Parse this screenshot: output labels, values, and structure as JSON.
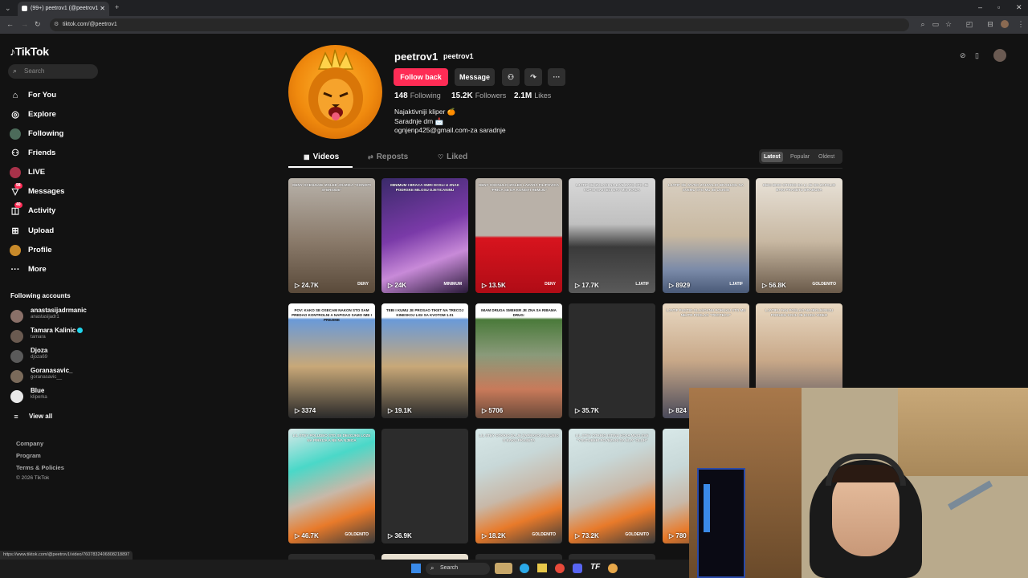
{
  "browser": {
    "tab_title": "(99+) peetrov1 (@peetrov1",
    "url": "tiktok.com/@peetrov1"
  },
  "sidebar": {
    "logo": "TikTok",
    "search_placeholder": "Search",
    "nav": [
      {
        "label": "For You",
        "icon": "home-icon"
      },
      {
        "label": "Explore",
        "icon": "compass-icon"
      },
      {
        "label": "Following",
        "icon": "following-avatar"
      },
      {
        "label": "Friends",
        "icon": "friends-icon"
      },
      {
        "label": "LIVE",
        "icon": "live-icon"
      },
      {
        "label": "Messages",
        "icon": "inbox-icon",
        "badge": "98"
      },
      {
        "label": "Activity",
        "icon": "bell-icon",
        "badge": "40"
      },
      {
        "label": "Upload",
        "icon": "plus-square-icon"
      },
      {
        "label": "Profile",
        "icon": "profile-avatar"
      },
      {
        "label": "More",
        "icon": "more-icon"
      }
    ],
    "following_heading": "Following accounts",
    "following": [
      {
        "name": "anastasijadrmanic",
        "handle": "anastasijadr1",
        "verified": false
      },
      {
        "name": "Tamara Kalinic",
        "handle": "tamara",
        "verified": true
      },
      {
        "name": "Djoza",
        "handle": "djoza69",
        "verified": false
      },
      {
        "name": "Goranasavic_",
        "handle": "goranasavic__",
        "verified": false
      },
      {
        "name": "Blue",
        "handle": "kliperka",
        "verified": false
      }
    ],
    "view_all": "View all",
    "footer": [
      "Company",
      "Program",
      "Terms & Policies",
      "© 2026 TikTok"
    ]
  },
  "profile": {
    "username": "peetrov1",
    "nickname": "peetrov1",
    "follow_back": "Follow back",
    "message": "Message",
    "following_count": "148",
    "following_label": "Following",
    "followers_count": "15.2K",
    "followers_label": "Followers",
    "likes_count": "2.1M",
    "likes_label": "Likes",
    "bio": [
      "Najaktivniji kliper 🍊",
      "Saradnje dm 📩",
      "ognjenp425@gmail.com-za saradnje"
    ]
  },
  "tabs": [
    "Videos",
    "Reposts",
    "Liked"
  ],
  "sort": [
    "Latest",
    "Popular",
    "Oldest"
  ],
  "videos": [
    {
      "views": "24.7K",
      "caption": "DENY OCENJUJE IZGLED JOJZIKA \"KONISTI STERIODE\"",
      "wm": "DENY"
    },
    {
      "views": "24K",
      "caption": "MINIMUM I BRACA SMRI DOSLI U ZNAK PODRSKE MILOSU DJETICANINU",
      "wm": "MINIMUM"
    },
    {
      "views": "13.5K",
      "caption": "DENY OSKNULO IZGLED LAZARA FILIPOVICA \"PRICA SE DA KONISTI HEMIJU\"",
      "wm": "DENY"
    },
    {
      "views": "17.7K",
      "caption": "LJATIF SE IZVLACI NA LIVE ZATO STO JE KUPIO NAJVECI DAY MIS IKADA",
      "wm": "LJATIF"
    },
    {
      "views": "8929",
      "caption": "LJATIF SE JAVNO ZAHVALIO BRABUSU NA SVEMU STO MU JE UCINIO",
      "wm": "LJATIF"
    },
    {
      "views": "56.8K",
      "caption": "DEKI BMW OTKRIO DA LI JE ON ZAPALIO BAKI PRASETU BRABUSA",
      "wm": "GOLDENITO"
    },
    {
      "views": "3374",
      "caption": "POV: KAKO SE OSECAM NAKON STO SAM PREDAO KONTROLNI A NAPISAO SAMO IME I PREZIME",
      "wm": ""
    },
    {
      "views": "19.1K",
      "caption": "TEBI I KUMU JE PROSAO TIKET NA TRECOJ KINESKOJ LIGI SA KVOTOM 1.01",
      "wm": ""
    },
    {
      "views": "5706",
      "caption": "IMAM DRUGA SMEKER JE ZNA SA RIBAMA DRUG:",
      "wm": ""
    },
    {
      "views": "35.7K",
      "caption": "",
      "wm": ""
    },
    {
      "views": "824",
      "caption": "LJATIF PUSTIO GLASOVNU PORUKU STO MU NEJTR POSLAO \"PROTECA\"",
      "wm": ""
    },
    {
      "views": "",
      "caption": "LJATIFU FAN POSLAO NAJBOLESNIJU PORUKU KOJU JE IKADA VIDEO",
      "wm": ""
    },
    {
      "views": "46.7K",
      "caption": "LIL STEY POLUDEO STO SE DEVOJKE LOZE NA PIRKIJA A NE NA NJEGA",
      "wm": "GOLDENITO"
    },
    {
      "views": "36.9K",
      "caption": "",
      "wm": ""
    },
    {
      "views": "18.2K",
      "caption": "LIL STEY OTKRIO DA JE ZAPRAVO ZALJUBIO U BAKU PRASETA",
      "wm": "GOLDENITO"
    },
    {
      "views": "73.2K",
      "caption": "LIL STEY OTKRIO ISTINU KOJA MUCI SVE \"YOUTUBERI POVEZANI SA ELA\" OLUR\"",
      "wm": "GOLDENITO"
    },
    {
      "views": "780",
      "caption": "LIL STEY O",
      "wm": ""
    }
  ],
  "status_url": "https://www.tiktok.com/@peetrov1/video/7607832406808218897",
  "taskbar": {
    "search": "Search"
  }
}
